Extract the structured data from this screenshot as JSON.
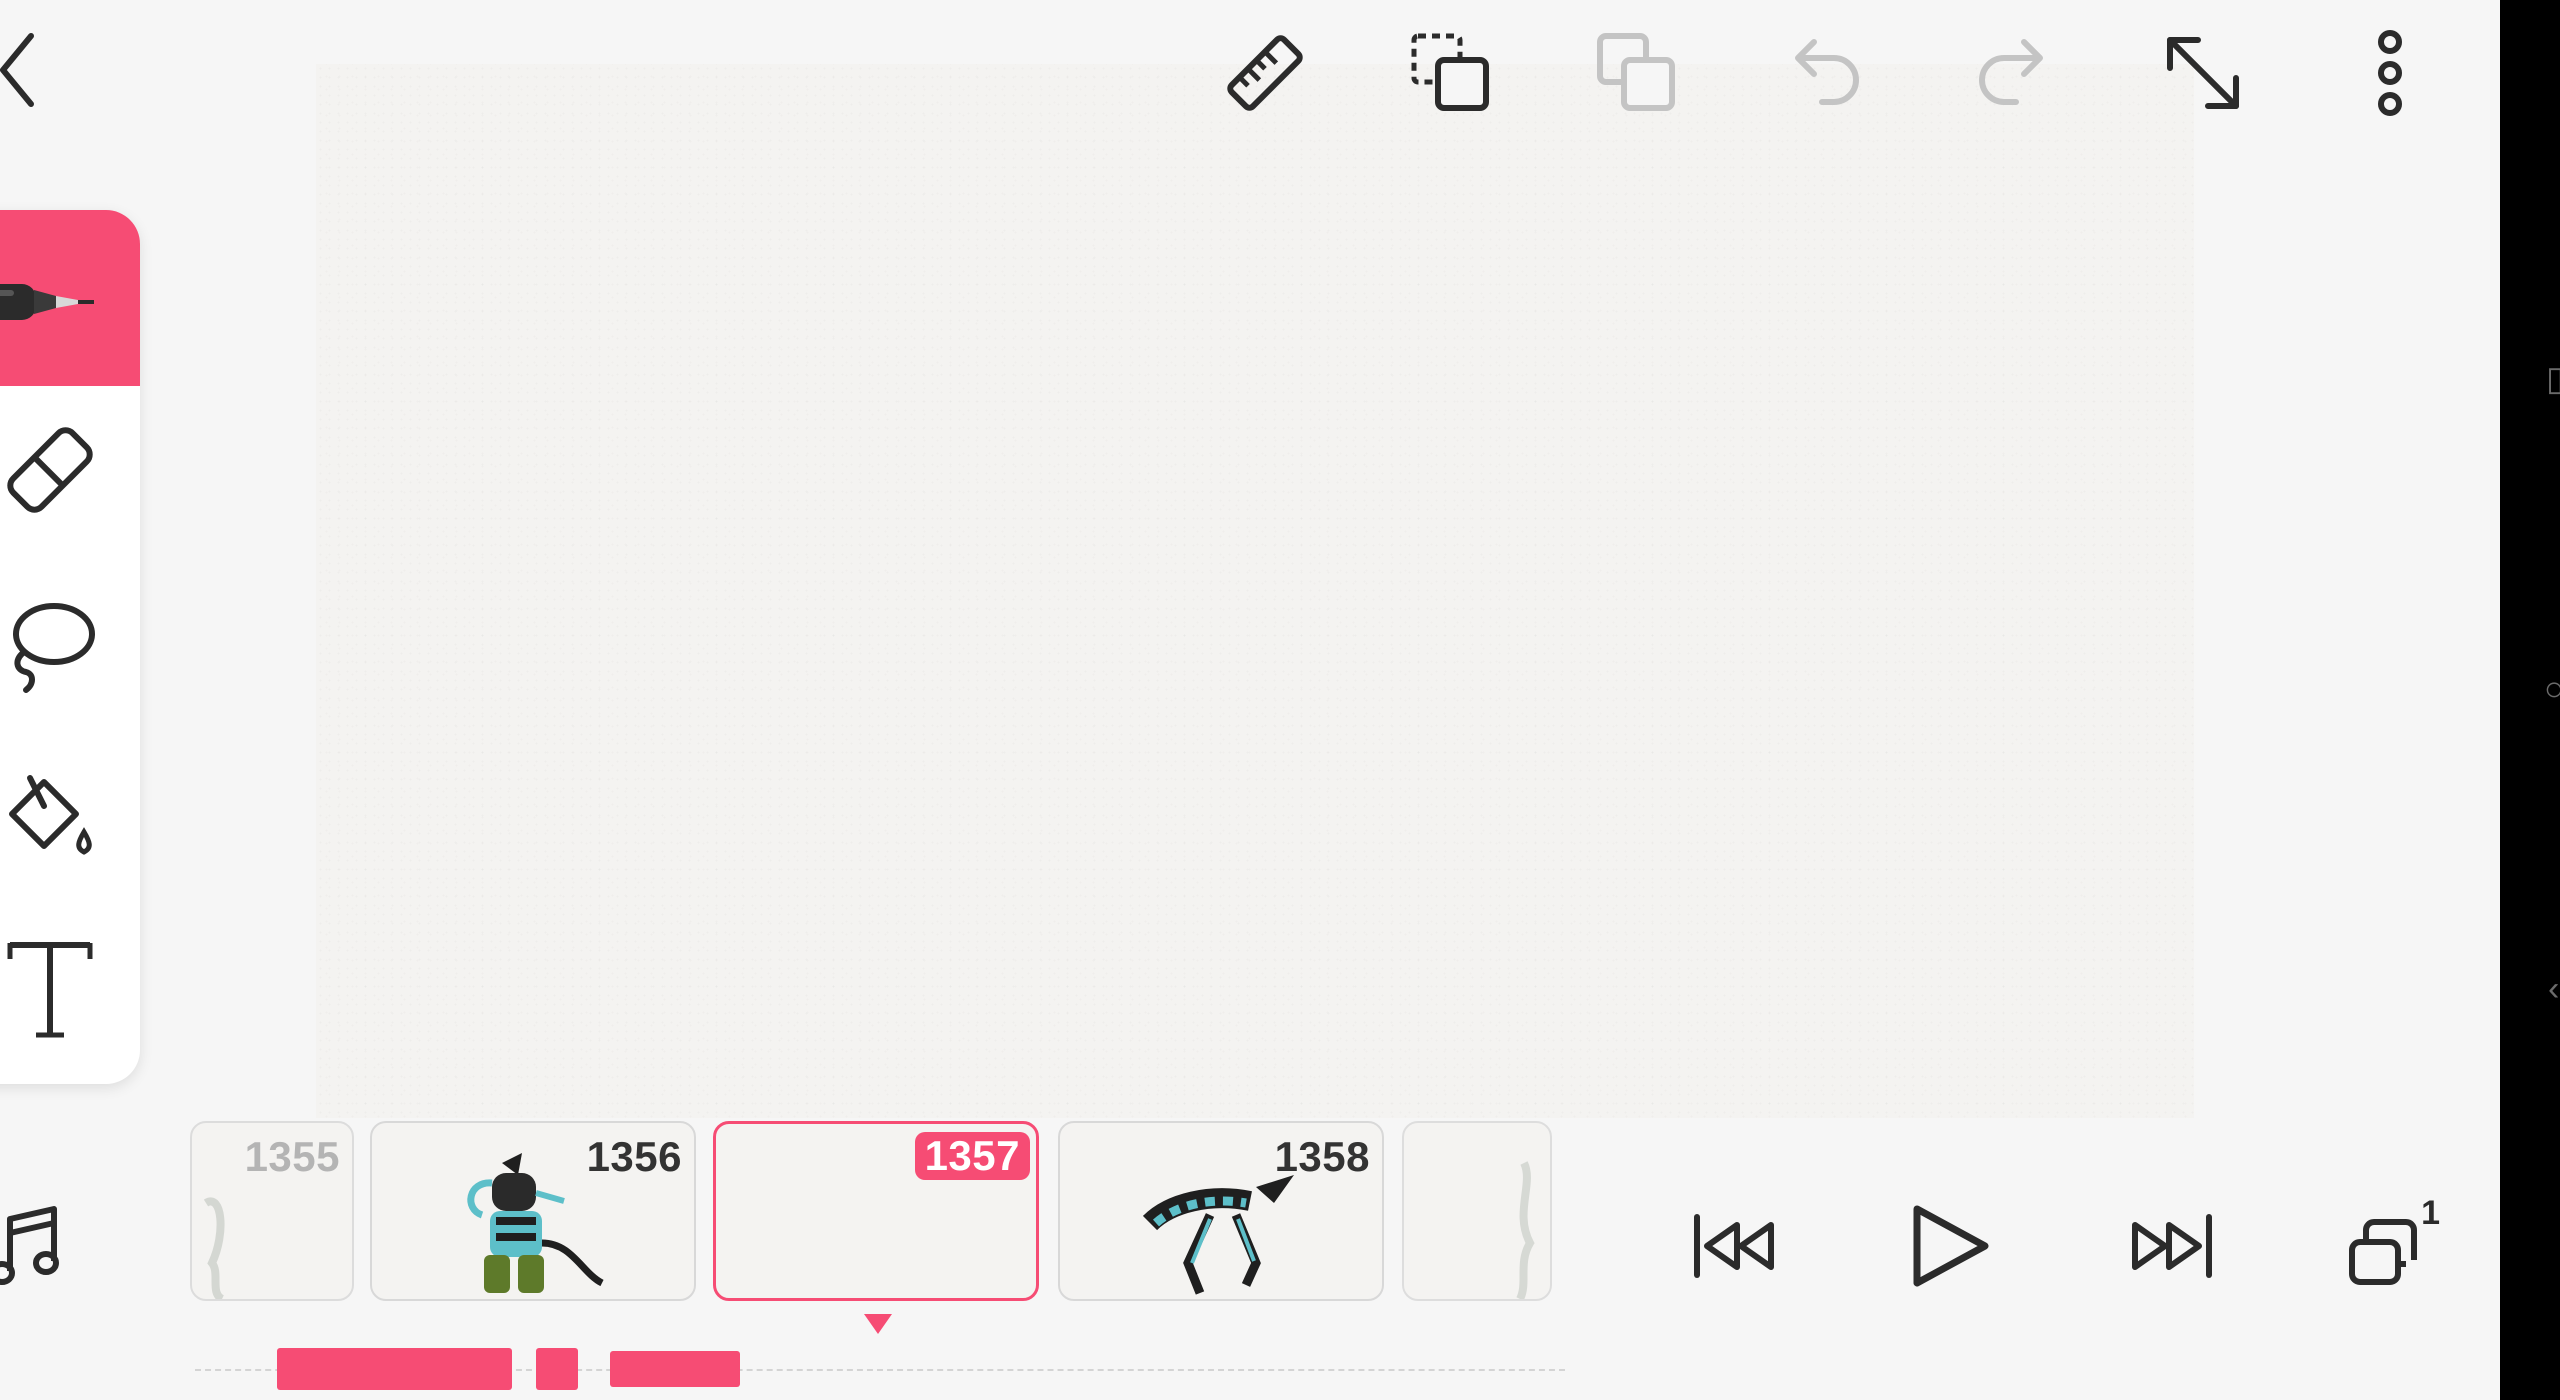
{
  "colors": {
    "accent": "#f64c74",
    "icon": "#2b2b2b",
    "icon_disabled": "#c4c4c4",
    "background": "#f6f6f6",
    "canvas": "#f4f3f1"
  },
  "toolbar": {
    "icons": [
      "back-icon",
      "ruler-icon",
      "copy-selection-icon",
      "duplicate-icon",
      "undo-icon",
      "redo-icon",
      "expand-icon",
      "more-icon"
    ]
  },
  "tools": [
    "pen-icon",
    "eraser-icon",
    "lasso-icon",
    "fill-bucket-icon",
    "text-icon"
  ],
  "timeline": {
    "frames": [
      {
        "number": "1355"
      },
      {
        "number": "1356"
      },
      {
        "number": "1357"
      },
      {
        "number": "1358"
      }
    ],
    "current_frame": "1357",
    "layers_count": "1"
  },
  "playback": {
    "icons": [
      "skip-to-start-icon",
      "play-icon",
      "skip-to-end-icon",
      "layers-icon"
    ]
  },
  "audio": {
    "icon": "music-note-icon"
  }
}
